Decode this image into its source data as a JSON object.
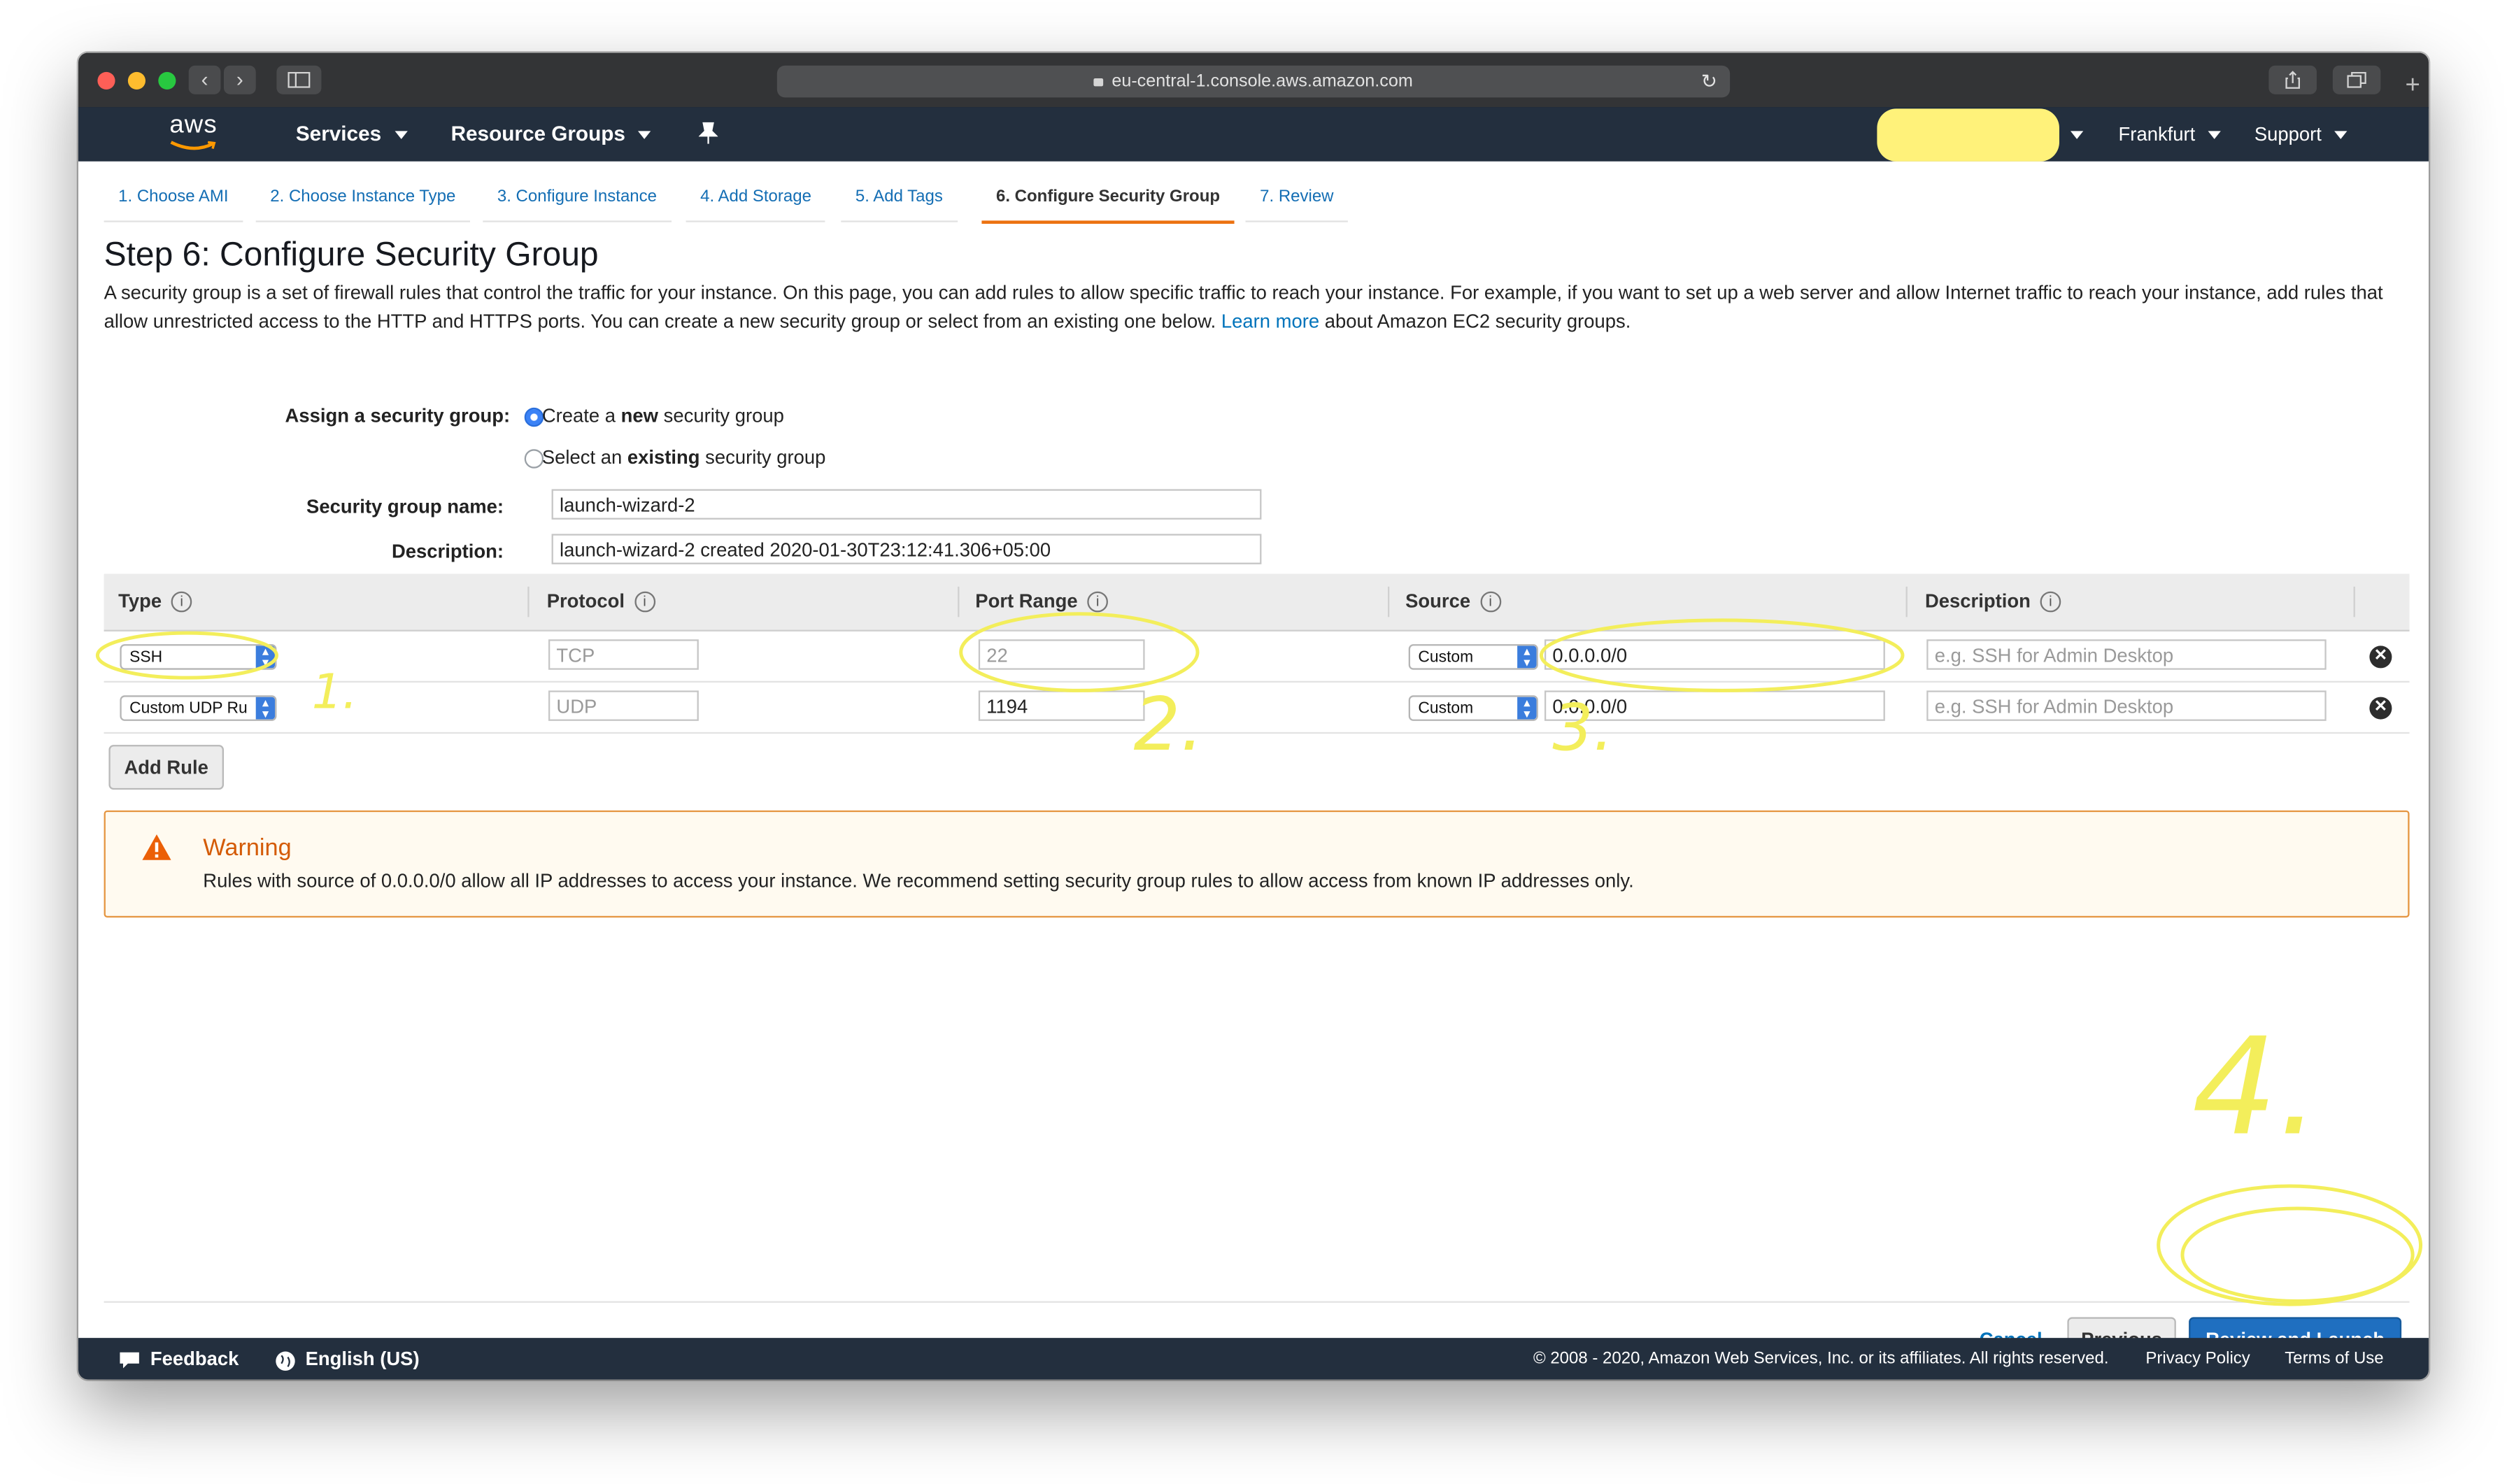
{
  "browser": {
    "url": "eu-central-1.console.aws.amazon.com",
    "back_icon": "‹",
    "forward_icon": "›",
    "reload_icon": "↻",
    "new_tab_icon": "+"
  },
  "aws_nav": {
    "logo": "aws",
    "services": "Services",
    "resource_groups": "Resource Groups",
    "region": "Frankfurt",
    "support": "Support",
    "account_highlight_color": "#fff27a"
  },
  "wizard": {
    "steps": [
      "1. Choose AMI",
      "2. Choose Instance Type",
      "3. Configure Instance",
      "4. Add Storage",
      "5. Add Tags",
      "6. Configure Security Group",
      "7. Review"
    ],
    "active_step": 6
  },
  "page": {
    "title": "Step 6: Configure Security Group",
    "intro": "A security group is a set of firewall rules that control the traffic for your instance. On this page, you can add rules to allow specific traffic to reach your instance. For example, if you want to set up a web server and allow Internet traffic to reach your instance, add rules that allow unrestricted access to the HTTP and HTTPS ports. You can create a new security group or select from an existing one below.",
    "learn_more": "Learn more",
    "intro_tail": "about Amazon EC2 security groups."
  },
  "assign": {
    "label": "Assign a security group:",
    "option_new_pre": "Create a ",
    "option_new_bold": "new",
    "option_new_post": " security group",
    "option_existing_pre": "Select an ",
    "option_existing_bold": "existing",
    "option_existing_post": " security group",
    "selected": "new"
  },
  "group": {
    "name_label": "Security group name:",
    "name_value": "launch-wizard-2",
    "description_label": "Description:",
    "description_value": "launch-wizard-2 created 2020-01-30T23:12:41.306+05:00"
  },
  "table": {
    "headers": [
      "Type",
      "Protocol",
      "Port Range",
      "Source",
      "Description"
    ],
    "info_icon": "i",
    "rows": [
      {
        "type": "SSH",
        "protocol": "TCP",
        "port": "22",
        "source_mode": "Custom",
        "source": "0.0.0.0/0",
        "description_placeholder": "e.g. SSH for Admin Desktop"
      },
      {
        "type": "Custom UDP Ru",
        "protocol": "UDP",
        "port": "1194",
        "source_mode": "Custom",
        "source": "0.0.0.0/0",
        "description_placeholder": "e.g. SSH for Admin Desktop"
      }
    ],
    "remove_icon": "✕",
    "add_rule": "Add Rule"
  },
  "warning": {
    "title": "Warning",
    "text": "Rules with source of 0.0.0.0/0 allow all IP addresses to access your instance. We recommend setting security group rules to allow access from known IP addresses only.",
    "icon": "!",
    "color": "#eb5f07"
  },
  "actions": {
    "cancel": "Cancel",
    "previous": "Previous",
    "review_launch": "Review and Launch"
  },
  "annotations": {
    "color": "#f3ee5b",
    "labels": [
      "1.",
      "2.",
      "3.",
      "4."
    ]
  },
  "footer": {
    "feedback": "Feedback",
    "language": "English (US)",
    "copyright": "© 2008 - 2020, Amazon Web Services, Inc. or its affiliates. All rights reserved.",
    "privacy": "Privacy Policy",
    "terms": "Terms of Use"
  }
}
